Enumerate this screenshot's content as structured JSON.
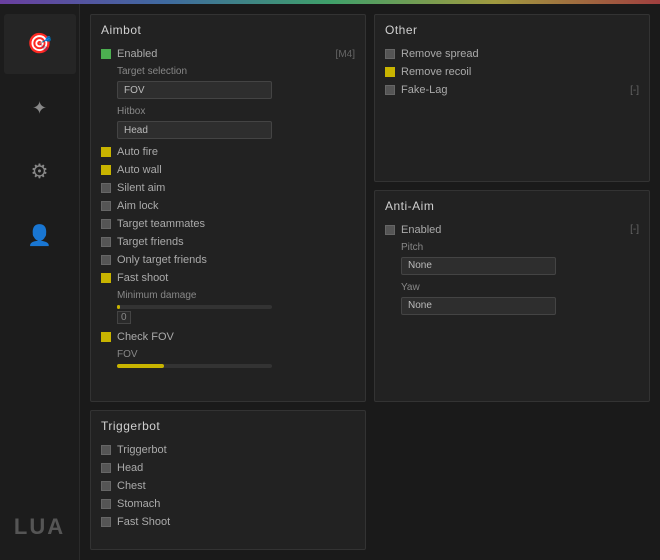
{
  "topbar": {},
  "sidebar": {
    "items": [
      {
        "id": "aimbot",
        "icon": "🎯",
        "label": "",
        "active": true
      },
      {
        "id": "visuals",
        "icon": "☀",
        "label": "",
        "active": false
      },
      {
        "id": "misc",
        "icon": "⚙",
        "label": "",
        "active": false
      },
      {
        "id": "players",
        "icon": "👤",
        "label": "",
        "active": false
      }
    ],
    "lua_label": "LUA"
  },
  "aimbot": {
    "title": "Aimbot",
    "enabled_label": "Enabled",
    "enabled_checked": true,
    "enabled_keybind": "[M4]",
    "target_selection_label": "Target selection",
    "target_selection_value": "FOV",
    "hitbox_label": "Hitbox",
    "hitbox_value": "Head",
    "rows": [
      {
        "label": "Auto fire",
        "checked": true,
        "type": "yellow"
      },
      {
        "label": "Auto wall",
        "checked": true,
        "type": "yellow"
      },
      {
        "label": "Silent aim",
        "checked": false,
        "type": "gray"
      },
      {
        "label": "Aim lock",
        "checked": false,
        "type": "gray"
      },
      {
        "label": "Target teammates",
        "checked": false,
        "type": "gray"
      },
      {
        "label": "Target friends",
        "checked": false,
        "type": "gray"
      },
      {
        "label": "Only target friends",
        "checked": false,
        "type": "gray"
      },
      {
        "label": "Fast shoot",
        "checked": true,
        "type": "yellow"
      }
    ],
    "minimum_damage_label": "Minimum damage",
    "minimum_damage_value": "0",
    "minimum_damage_percent": 2,
    "check_fov_label": "Check FOV",
    "check_fov_checked": true,
    "fov_label": "FOV",
    "fov_percent": 30
  },
  "other": {
    "title": "Other",
    "rows": [
      {
        "label": "Remove spread",
        "checked": false,
        "type": "gray"
      },
      {
        "label": "Remove recoil",
        "checked": true,
        "type": "yellow"
      },
      {
        "label": "Fake-Lag",
        "checked": false,
        "type": "gray",
        "keybind": "[-]"
      }
    ]
  },
  "anti_aim": {
    "title": "Anti-Aim",
    "enabled_label": "Enabled",
    "enabled_keybind": "[-]",
    "pitch_label": "Pitch",
    "pitch_value": "None",
    "yaw_label": "Yaw",
    "yaw_value": "None"
  },
  "triggerbot": {
    "title": "Triggerbot",
    "rows": [
      {
        "label": "Triggerbot",
        "checked": false,
        "type": "gray"
      },
      {
        "label": "Head",
        "checked": false,
        "type": "gray"
      },
      {
        "label": "Chest",
        "checked": false,
        "type": "gray"
      },
      {
        "label": "Stomach",
        "checked": false,
        "type": "gray"
      },
      {
        "label": "Fast Shoot",
        "checked": false,
        "type": "gray"
      }
    ]
  }
}
